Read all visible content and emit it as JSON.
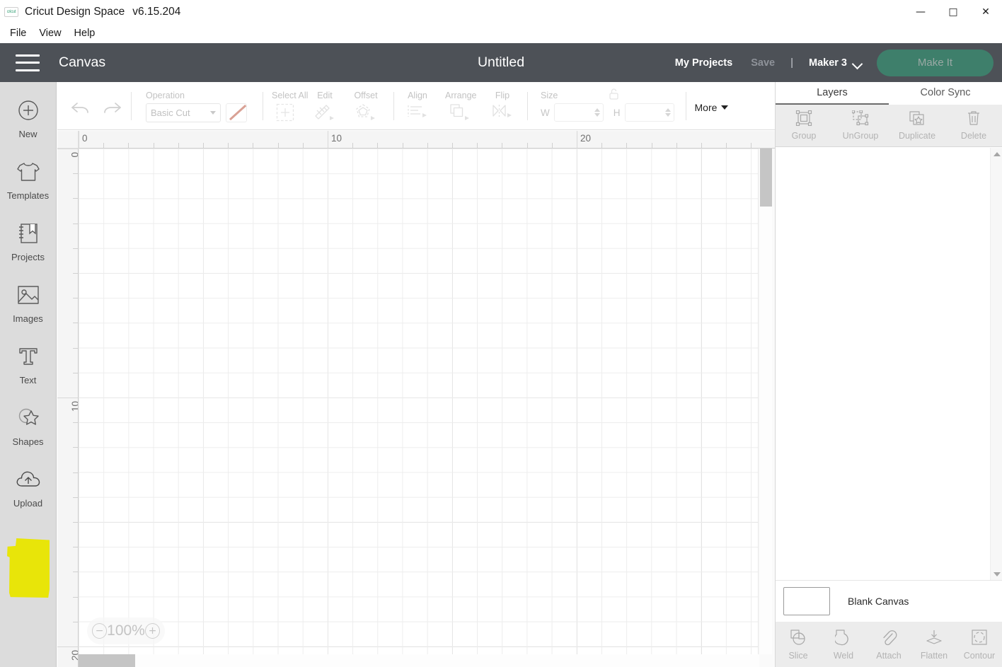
{
  "titlebar": {
    "app_name": "Cricut Design Space",
    "version": "v6.15.204",
    "logo_text": "cricut",
    "minimize": "—",
    "maximize": "□",
    "close": "✕"
  },
  "menubar": {
    "items": [
      {
        "label": "File"
      },
      {
        "label": "View"
      },
      {
        "label": "Help"
      }
    ]
  },
  "header": {
    "canvas_label": "Canvas",
    "document_title": "Untitled",
    "my_projects": "My Projects",
    "save": "Save",
    "divider": "|",
    "machine": "Maker 3",
    "make_it": "Make It",
    "bg_color": "#4d5157",
    "make_it_color": "#3e7f6b"
  },
  "sidebar": {
    "items": [
      {
        "label": "New",
        "icon": "plus-circle-icon"
      },
      {
        "label": "Templates",
        "icon": "tshirt-icon"
      },
      {
        "label": "Projects",
        "icon": "bookmark-book-icon"
      },
      {
        "label": "Images",
        "icon": "picture-icon"
      },
      {
        "label": "Text",
        "icon": "text-t-icon"
      },
      {
        "label": "Shapes",
        "icon": "star-shapes-icon"
      },
      {
        "label": "Upload",
        "icon": "cloud-upload-icon"
      }
    ],
    "highlight_color": "#e8e509",
    "highlighted_item": "Upload"
  },
  "toolbar": {
    "undo": "undo-icon",
    "redo": "redo-icon",
    "operation_label": "Operation",
    "operation_value": "Basic Cut",
    "operation_swatch_color": "#d9a195",
    "select_all_label": "Select All",
    "edit_label": "Edit",
    "offset_label": "Offset",
    "align_label": "Align",
    "arrange_label": "Arrange",
    "flip_label": "Flip",
    "size_label": "Size",
    "width_label": "W",
    "width_value": "",
    "height_label": "H",
    "height_value": "",
    "lock_icon": "unlocked-padlock-icon",
    "more_label": "More"
  },
  "canvas": {
    "zoom_level": "100%",
    "zoom_out": "−",
    "zoom_in": "+",
    "ruler_h_labels": [
      "0",
      "10",
      "20"
    ],
    "ruler_v_labels": [
      "0",
      "10",
      "20"
    ],
    "grid_minor_color": "#ededed",
    "grid_major_color": "#c9c9c9"
  },
  "right_panel": {
    "tabs": [
      {
        "label": "Layers",
        "active": true
      },
      {
        "label": "Color Sync",
        "active": false
      }
    ],
    "tools": [
      {
        "label": "Group",
        "icon": "group-icon"
      },
      {
        "label": "UnGroup",
        "icon": "ungroup-icon"
      },
      {
        "label": "Duplicate",
        "icon": "duplicate-icon"
      },
      {
        "label": "Delete",
        "icon": "trash-icon"
      }
    ],
    "layer_row": {
      "name": "Blank Canvas",
      "swatch_color": "#ffffff"
    },
    "bottom_tools": [
      {
        "label": "Slice",
        "icon": "slice-icon"
      },
      {
        "label": "Weld",
        "icon": "weld-icon"
      },
      {
        "label": "Attach",
        "icon": "paperclip-icon"
      },
      {
        "label": "Flatten",
        "icon": "flatten-icon"
      },
      {
        "label": "Contour",
        "icon": "contour-icon"
      }
    ]
  }
}
